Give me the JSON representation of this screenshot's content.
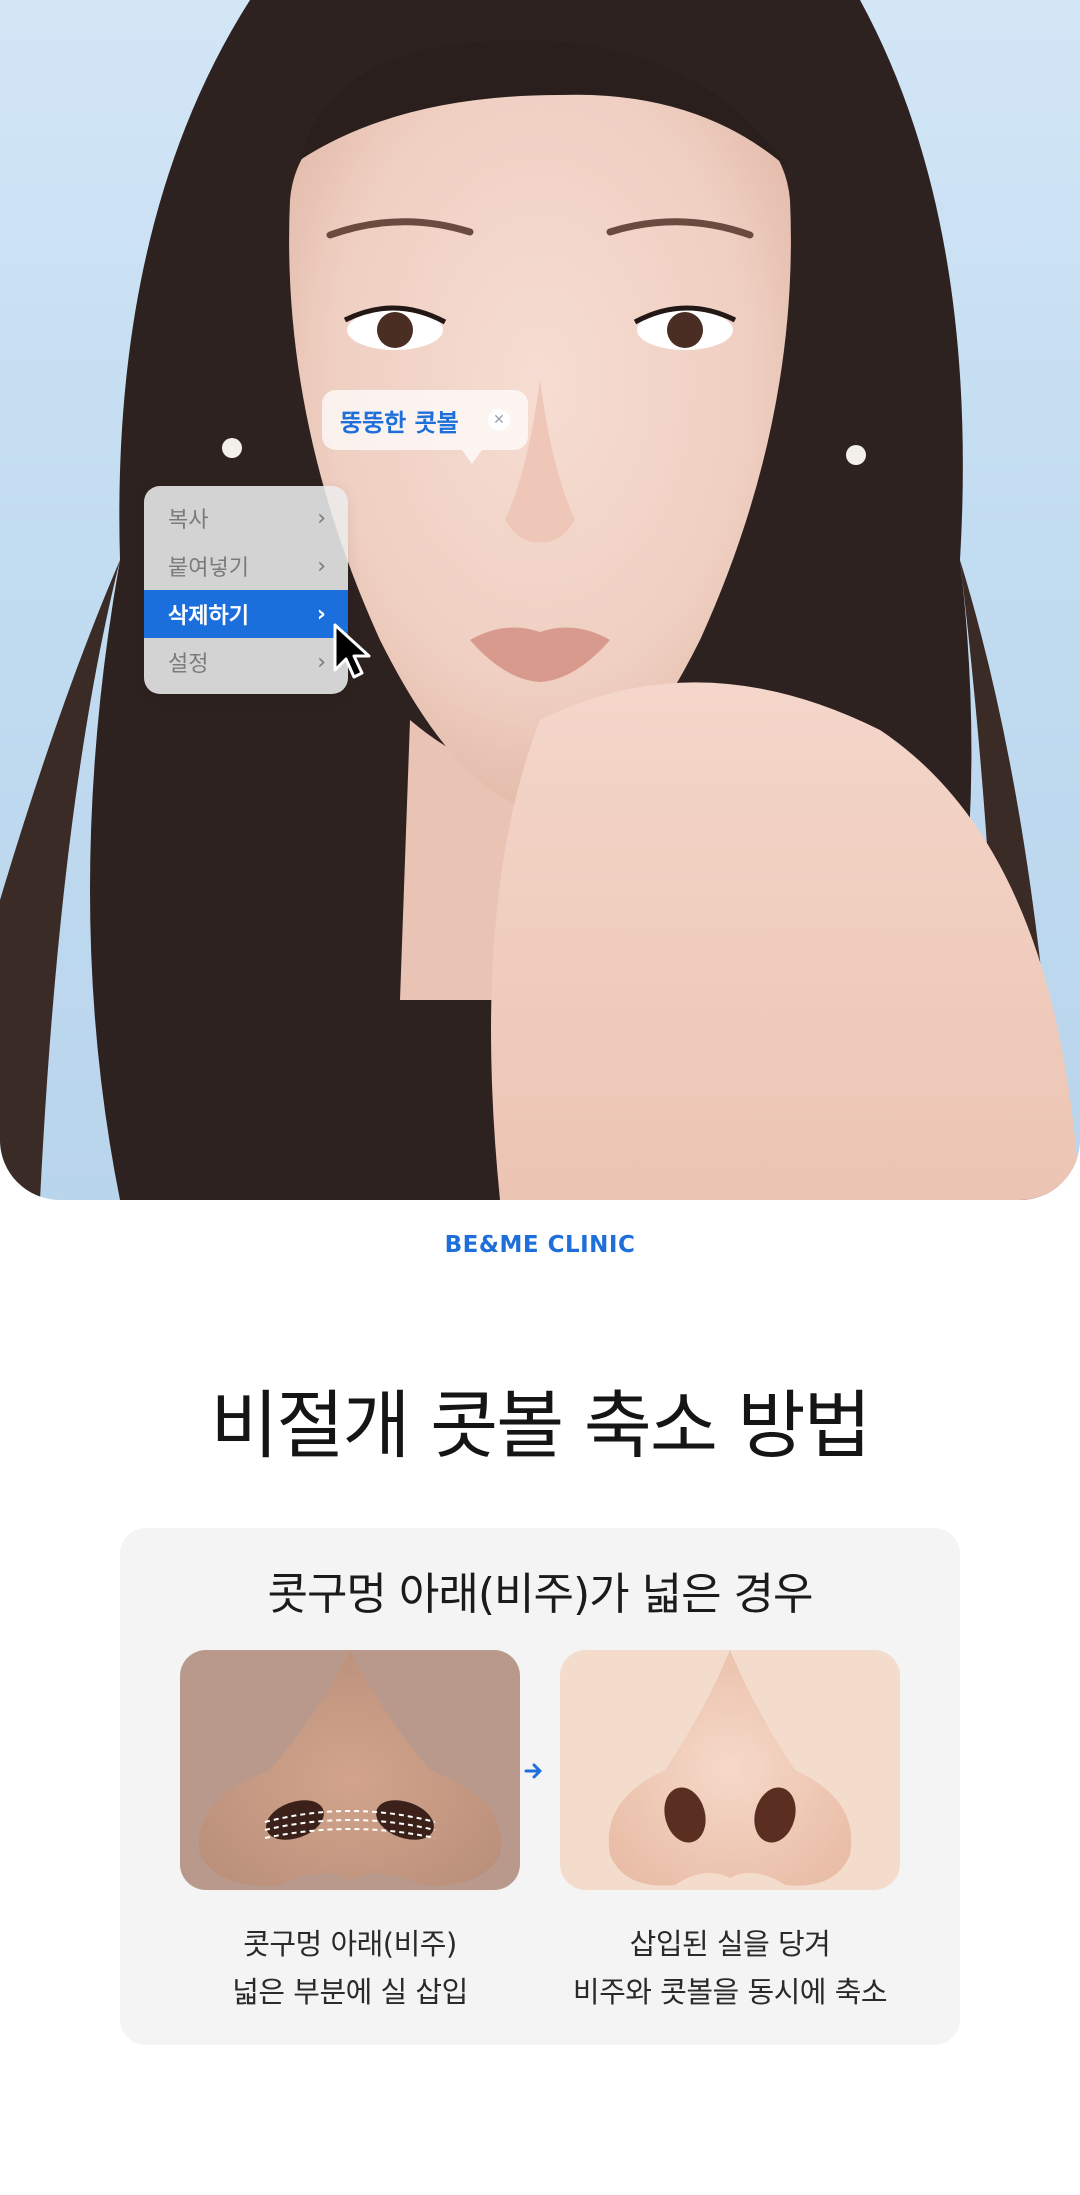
{
  "hero": {
    "tag": {
      "label": "뚱뚱한 콧볼",
      "close_icon": "close-icon"
    },
    "context_menu": {
      "items": [
        {
          "label": "복사",
          "active": false
        },
        {
          "label": "붙여넣기",
          "active": false
        },
        {
          "label": "삭제하기",
          "active": true
        },
        {
          "label": "설정",
          "active": false
        }
      ],
      "chevron_icon": "chevron-right-icon",
      "cursor_icon": "mouse-pointer-icon"
    },
    "colors": {
      "accent": "#1a6fdd",
      "background": "#c2dcf1"
    }
  },
  "clinic": {
    "name": "BE&ME CLINIC"
  },
  "page": {
    "title": "비절개 콧볼 축소 방법"
  },
  "card": {
    "title": "콧구멍 아래(비주)가 넓은 경우",
    "arrow_icon": "arrow-right-icon",
    "steps": [
      {
        "image": "nose-before-thread-insert",
        "line1": "콧구멍 아래(비주)",
        "line2": "넓은 부분에 실 삽입"
      },
      {
        "image": "nose-after-reduction",
        "line1": "삽입된 실을 당겨",
        "line2": "비주와 콧볼을 동시에 축소"
      }
    ]
  }
}
